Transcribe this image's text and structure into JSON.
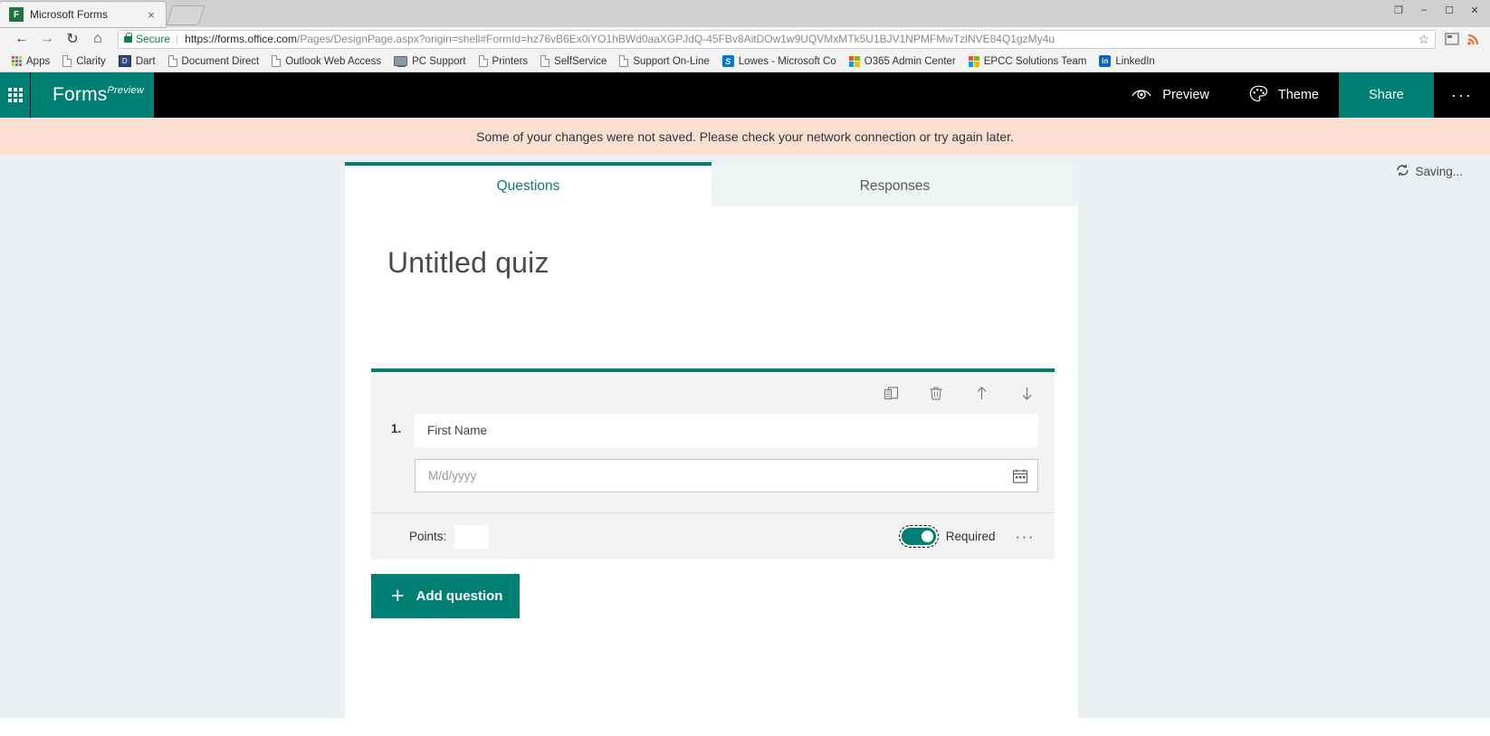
{
  "browser": {
    "tab": {
      "title": "Microsoft Forms",
      "favicon": "forms-favicon",
      "close": "×"
    },
    "new_tab_label": "",
    "window_controls": {
      "restore_down": "❐",
      "minimize": "–",
      "maximize": "☐",
      "close": "✕"
    },
    "nav": {
      "back": "←",
      "forward": "→",
      "reload": "↻",
      "home": "⌂"
    },
    "omnibox": {
      "secure_label": "Secure",
      "url_domain": "https://forms.office.com",
      "url_path": "/Pages/DesignPage.aspx?origin=shell#FormId=hz76vB6Ex0iYO1hBWd0aaXGPJdQ-45FBv8AitDOw1w9UQVMxMTk5U1BJV1NPMFMwTzlNVE84Q1gzMy4u",
      "star": "☆"
    },
    "bookmarks": [
      {
        "label": "Apps",
        "icon": "apps-grid-icon"
      },
      {
        "label": "Clarity",
        "icon": "document-icon"
      },
      {
        "label": "Dart",
        "icon": "dart-icon"
      },
      {
        "label": "Document Direct",
        "icon": "document-icon"
      },
      {
        "label": "Outlook Web Access",
        "icon": "document-icon"
      },
      {
        "label": "PC Support",
        "icon": "pc-support-icon"
      },
      {
        "label": "Printers",
        "icon": "document-icon"
      },
      {
        "label": "SelfService",
        "icon": "document-icon"
      },
      {
        "label": "Support On-Line",
        "icon": "document-icon"
      },
      {
        "label": "Lowes - Microsoft Co",
        "icon": "sharepoint-icon"
      },
      {
        "label": "O365 Admin Center",
        "icon": "microsoft-icon"
      },
      {
        "label": "EPCC Solutions Team",
        "icon": "microsoft-icon"
      },
      {
        "label": "LinkedIn",
        "icon": "linkedin-icon"
      }
    ]
  },
  "app": {
    "waffle": "app-launcher-icon",
    "brand": "Forms",
    "brand_sup": "Preview",
    "preview_label": "Preview",
    "preview_icon": "eye-icon",
    "theme_label": "Theme",
    "theme_icon": "palette-icon",
    "share_label": "Share",
    "more_label": "···"
  },
  "banner": {
    "message": "Some of your changes were not saved. Please check your network connection or try again later.",
    "background": "#fbdfd3"
  },
  "status": {
    "saving_label": "Saving...",
    "saving_icon": "sync-icon"
  },
  "form": {
    "tabs": [
      {
        "label": "Questions",
        "active": true
      },
      {
        "label": "Responses",
        "active": false
      }
    ],
    "title": "Untitled quiz",
    "accent_color": "#007f73",
    "question": {
      "number": "1.",
      "title": "First Name",
      "date_placeholder": "M/d/yyyy",
      "calendar_icon": "calendar-icon",
      "toolbar": [
        {
          "name": "duplicate-icon",
          "glyph": "copy"
        },
        {
          "name": "delete-icon",
          "glyph": "trash"
        },
        {
          "name": "move-up-icon",
          "glyph": "↑"
        },
        {
          "name": "move-down-icon",
          "glyph": "↓"
        }
      ],
      "points_label": "Points:",
      "points_value": "",
      "required_label": "Required",
      "required_on": true,
      "more_options": "···"
    },
    "add_question_label": "Add question",
    "add_question_icon": "plus-icon"
  }
}
